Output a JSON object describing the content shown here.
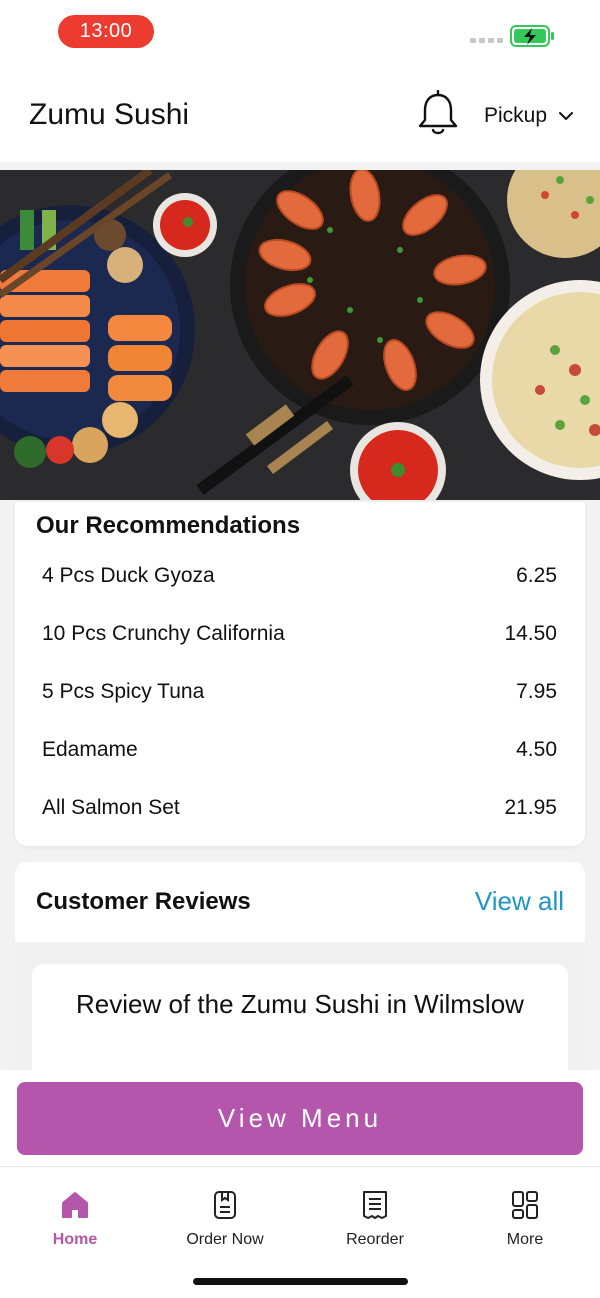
{
  "status_bar": {
    "time": "13:00",
    "signal_icon": "signal-dots-icon",
    "battery_icon": "battery-charging-icon"
  },
  "header": {
    "title": "Zumu Sushi",
    "bell_icon": "bell-icon",
    "order_mode": "Pickup",
    "order_mode_icon": "chevron-down-icon"
  },
  "hero": {
    "description_icon": "food-banner-image"
  },
  "recommendations": {
    "title": "Our Recommendations",
    "items": [
      {
        "name": "4 Pcs Duck Gyoza",
        "price": "6.25"
      },
      {
        "name": "10 Pcs Crunchy California",
        "price": "14.50"
      },
      {
        "name": "5 Pcs Spicy Tuna",
        "price": "7.95"
      },
      {
        "name": "Edamame",
        "price": "4.50"
      },
      {
        "name": "All Salmon Set",
        "price": "21.95"
      }
    ]
  },
  "reviews": {
    "title": "Customer Reviews",
    "view_all": "View all",
    "card_title": "Review of the Zumu Sushi in Wilmslow"
  },
  "view_menu_label": "View Menu",
  "tabs": [
    {
      "label": "Home",
      "icon": "home-icon",
      "active": true
    },
    {
      "label": "Order Now",
      "icon": "menu-book-icon",
      "active": false
    },
    {
      "label": "Reorder",
      "icon": "receipt-icon",
      "active": false
    },
    {
      "label": "More",
      "icon": "grid-icon",
      "active": false
    }
  ],
  "colors": {
    "accent": "#b556ad",
    "link": "#1f95c6",
    "status_time_bg": "#ec3b2f",
    "battery": "#34c759"
  }
}
